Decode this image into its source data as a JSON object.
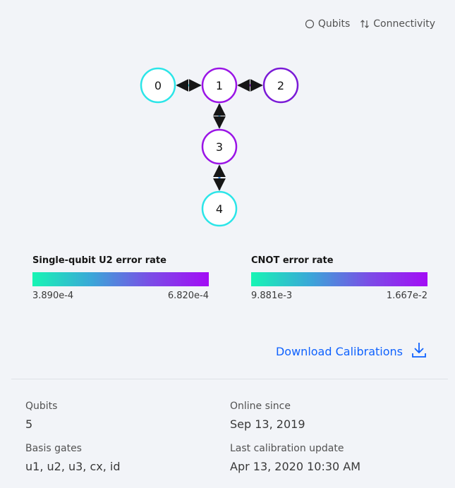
{
  "toolbar": {
    "qubits_label": "Qubits",
    "qubits_icon": "circle-icon",
    "connectivity_label": "Connectivity",
    "connectivity_icon": "swap-arrows-icon"
  },
  "graph": {
    "nodes": [
      {
        "id": "0",
        "label": "0",
        "color": "#2be5e8"
      },
      {
        "id": "1",
        "label": "1",
        "color": "#9a14e6"
      },
      {
        "id": "2",
        "label": "2",
        "color": "#7a1ad6"
      },
      {
        "id": "3",
        "label": "3",
        "color": "#9a14e6"
      },
      {
        "id": "4",
        "label": "4",
        "color": "#2be5e8"
      }
    ],
    "edges": [
      {
        "from": "0",
        "to": "1",
        "color": "#2ad8e6"
      },
      {
        "from": "1",
        "to": "2",
        "color": "#a30cf5"
      },
      {
        "from": "1",
        "to": "3",
        "color": "#2f9de0"
      },
      {
        "from": "3",
        "to": "4",
        "color": "#2a7ee0"
      }
    ]
  },
  "legends": {
    "single": {
      "title": "Single-qubit U2 error rate",
      "min": "3.890e-4",
      "max": "6.820e-4"
    },
    "cnot": {
      "title": "CNOT error rate",
      "min": "9.881e-3",
      "max": "1.667e-2"
    },
    "gradient_colors": [
      "#17f5b4",
      "#3aa7d8",
      "#7b4de6",
      "#a30cf5"
    ]
  },
  "download": {
    "label": "Download Calibrations",
    "icon": "download-icon"
  },
  "details": {
    "qubits_label": "Qubits",
    "qubits_value": "5",
    "online_label": "Online since",
    "online_value": "Sep 13, 2019",
    "gates_label": "Basis gates",
    "gates_value": "u1, u2, u3, cx, id",
    "calib_label": "Last calibration update",
    "calib_value": "Apr 13, 2020 10:30 AM"
  },
  "colors": {
    "accent": "#0f62fe",
    "background": "#f2f4f8"
  }
}
